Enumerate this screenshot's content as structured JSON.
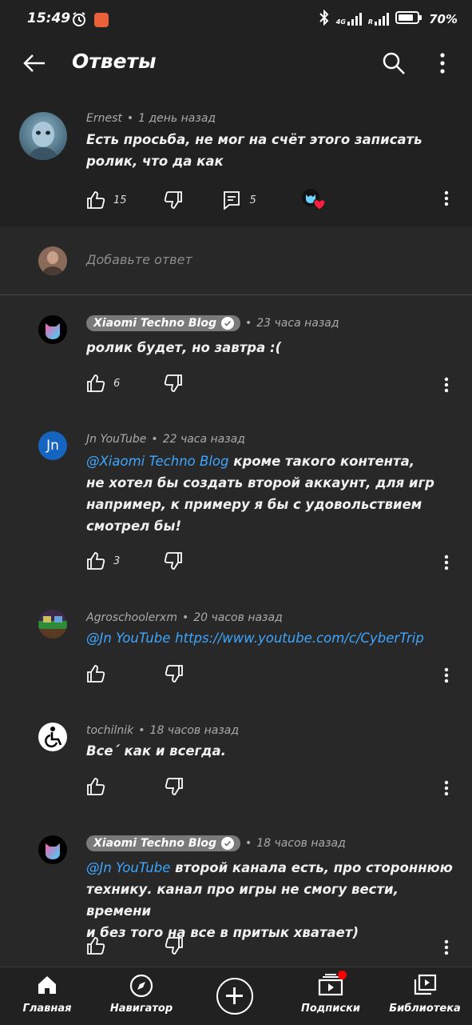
{
  "status": {
    "time": "15:49",
    "network": "4G",
    "roaming": "R",
    "battery": "70%"
  },
  "header": {
    "title": "Ответы"
  },
  "parent_comment": {
    "author": "Ernest",
    "time": "1 день назад",
    "text_line1": "Есть просьба, не мог на счёт этого записать",
    "text_line2": "ролик, что да как",
    "likes": "15",
    "replies": "5"
  },
  "add_reply": {
    "placeholder": "Добавьте ответ"
  },
  "replies": [
    {
      "author": "Xiaomi Techno Blog",
      "verified": true,
      "time": "23 часа назад",
      "text": "ролик будет, но завтра :(",
      "likes": "6"
    },
    {
      "author": "Jn YouTube",
      "avatar_text": "Jn",
      "time": "22 часа назад",
      "mention": "@Xiaomi Techno Blog",
      "text_l1": " кроме такого контента,",
      "text_l2": "не хотел бы создать второй аккаунт, для игр",
      "text_l3": "например, к примеру я бы с удовольствием",
      "text_l4": "смотрел бы!",
      "likes": "3"
    },
    {
      "author": "Agroschoolerxm",
      "time": "20 часов назад",
      "mention": "@Jn YouTube",
      "link": "https://www.youtube.com/c/CyberTrip"
    },
    {
      "author": "tochilnik",
      "time": "18 часов назад",
      "text": "Все´ как и всегда."
    },
    {
      "author": "Xiaomi Techno Blog",
      "verified": true,
      "time": "18 часов назад",
      "mention": "@Jn YouTube",
      "text_l1": " второй канала есть, про стороннюю",
      "text_l2": "технику. канал про игры не смогу вести, времени",
      "text_l3": "и без того на все в притык хватает)"
    }
  ],
  "bottom_nav": {
    "home": "Главная",
    "explore": "Навигатор",
    "subscriptions": "Подписки",
    "library": "Библиотека"
  },
  "colors": {
    "background": "#282828",
    "surface": "#212121",
    "link": "#3ea6ff",
    "badge": "#ff0000"
  }
}
